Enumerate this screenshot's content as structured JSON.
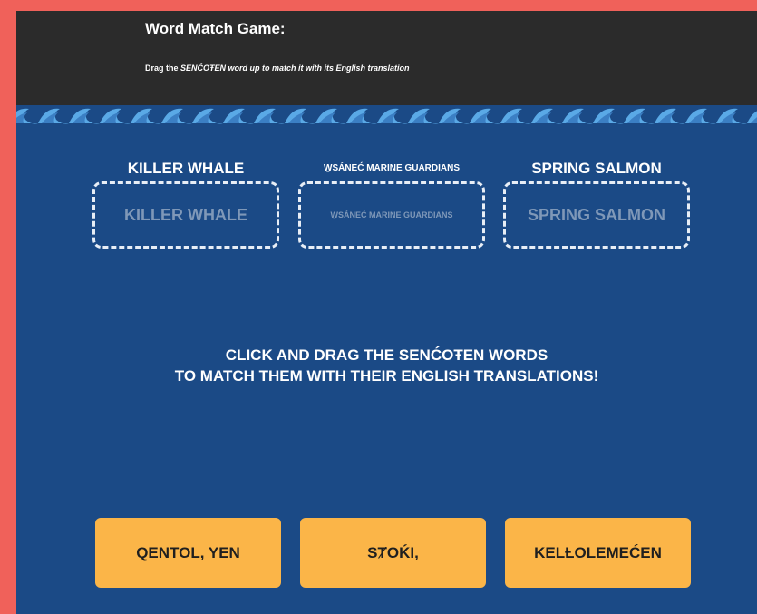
{
  "header": {
    "title": "Word Match Game:",
    "instruction_prefix": "Drag the ",
    "instruction_emphasis": "SENĆOŦEN word up to match it with its English translation"
  },
  "slots": [
    {
      "label": "KILLER WHALE",
      "placeholder": "KILLER WHALE"
    },
    {
      "label": "W̱SÁNEĆ MARINE GUARDIANS",
      "placeholder": "W̱SÁNEĆ MARINE GUARDIANS"
    },
    {
      "label": "SPRING SALMON",
      "placeholder": "SPRING SALMON"
    }
  ],
  "prompt": {
    "line1": "CLICK AND DRAG THE SENĆOŦEN WORDS",
    "line2": "TO MATCH THEM WITH THEIR ENGLISH TRANSLATIONS!"
  },
  "words": [
    {
      "text": "QENTOL, YEN"
    },
    {
      "text": "SȾOḰI,"
    },
    {
      "text": "KELȽOLEMEĆEN"
    }
  ],
  "colors": {
    "page_border": "#f0615a",
    "header_bg": "#2b2b2b",
    "ocean_bg": "#1b4a86",
    "wave_light": "#5aa9e6",
    "wave_dark": "#3b7fc4",
    "word_button": "#fbb548",
    "slot_border": "#e8eef6",
    "slot_placeholder": "#7f98b8"
  }
}
